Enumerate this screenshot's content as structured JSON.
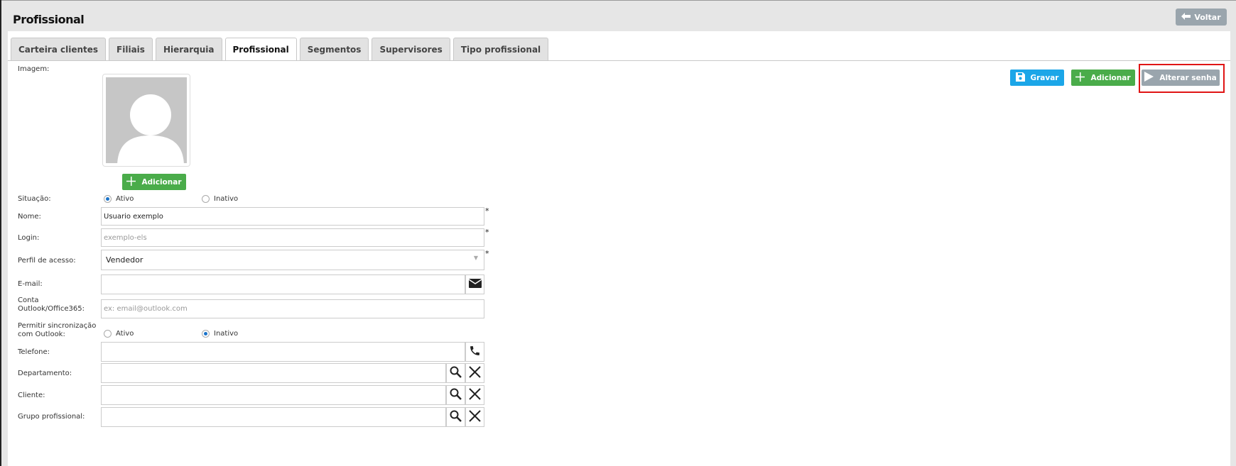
{
  "header": {
    "title": "Profissional",
    "back_label": "Voltar"
  },
  "tabs": [
    {
      "label": "Carteira clientes",
      "active": false
    },
    {
      "label": "Filiais",
      "active": false
    },
    {
      "label": "Hierarquia",
      "active": false
    },
    {
      "label": "Profissional",
      "active": true
    },
    {
      "label": "Segmentos",
      "active": false
    },
    {
      "label": "Supervisores",
      "active": false
    },
    {
      "label": "Tipo profissional",
      "active": false
    }
  ],
  "toolbar": {
    "save_label": "Gravar",
    "add_label": "Adicionar",
    "change_password_label": "Alterar senha"
  },
  "form": {
    "image_label": "Imagem:",
    "image_add_label": "Adicionar",
    "status": {
      "label": "Situação:",
      "options": [
        "Ativo",
        "Inativo"
      ],
      "selected": "Ativo"
    },
    "name": {
      "label": "Nome:",
      "value": "Usuario exemplo",
      "required": "*"
    },
    "login": {
      "label": "Login:",
      "placeholder": "exemplo-els",
      "required": "*"
    },
    "profile": {
      "label": "Perfil de acesso:",
      "value": "Vendedor",
      "required": "*"
    },
    "email": {
      "label": "E-mail:",
      "value": ""
    },
    "outlook_account": {
      "label_line1": "Conta",
      "label_line2": "Outlook/Office365:",
      "placeholder": "ex: email@outlook.com"
    },
    "outlook_sync": {
      "label_line1": "Permitir sincronização",
      "label_line2": "com Outlook:",
      "options": [
        "Ativo",
        "Inativo"
      ],
      "selected": "Inativo"
    },
    "phone": {
      "label": "Telefone:",
      "value": ""
    },
    "department": {
      "label": "Departamento:",
      "value": ""
    },
    "client": {
      "label": "Cliente:",
      "value": ""
    },
    "professional_group": {
      "label": "Grupo profissional:",
      "value": ""
    }
  },
  "colors": {
    "green": "#4aac4a",
    "blue": "#1ba6e8",
    "grey": "#9aa5ad",
    "highlight": "#e01515"
  }
}
